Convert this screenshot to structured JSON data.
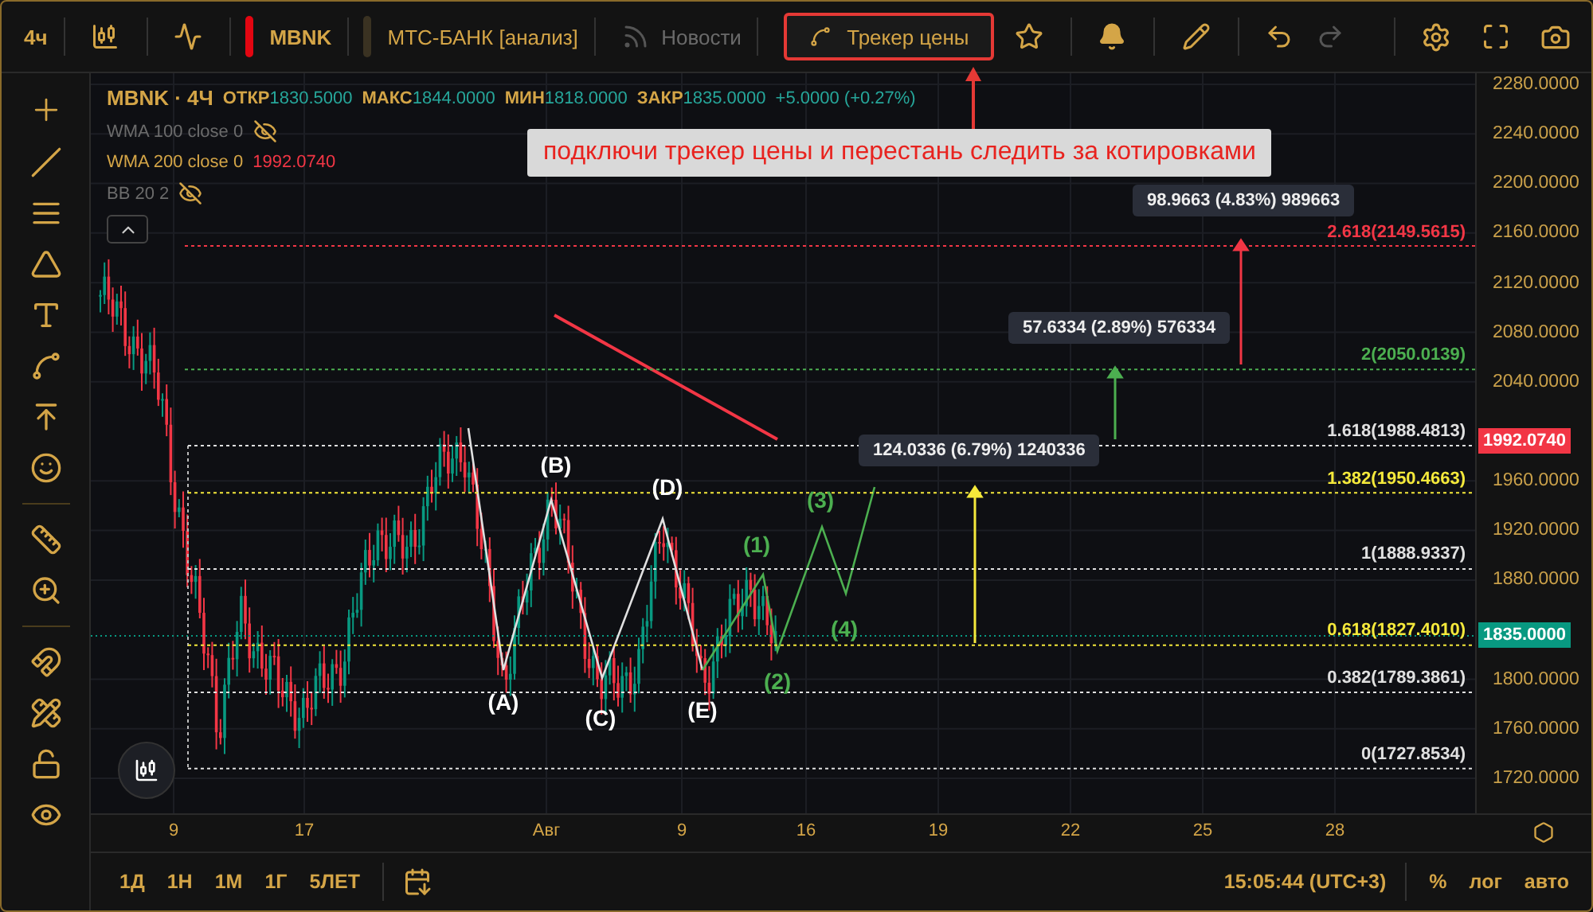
{
  "toolbar": {
    "interval": "4ч",
    "symbol": "MBNK",
    "analysis": "МТС-БАНК [анализ]",
    "news": {
      "label": "Новости",
      "disabled": true
    },
    "tracker": {
      "label": "Трекер цены",
      "highlighted": true
    },
    "redo": {
      "disabled": true
    }
  },
  "callout": {
    "text": "подключи трекер цены и перестань следить за котировками"
  },
  "legend": {
    "title": "MBNK · 4Ч",
    "ohlc": [
      {
        "label": "ОТКР",
        "value": "1830.5000"
      },
      {
        "label": "МАКС",
        "value": "1844.0000"
      },
      {
        "label": "МИН",
        "value": "1818.0000"
      },
      {
        "label": "ЗАКР",
        "value": "1835.0000"
      }
    ],
    "change": "+5.0000 (+0.27%)",
    "indicators": [
      {
        "name": "WMA 100 close 0",
        "visible": false
      },
      {
        "name": "WMA 200 close 0",
        "visible": true,
        "value": "1992.0740"
      },
      {
        "name": "BB 20 2",
        "visible": false
      }
    ]
  },
  "fib_levels": [
    {
      "label": "2.618(2149.5615)",
      "color": "#f23645"
    },
    {
      "label": "2(2050.0139)",
      "color": "#4caf50"
    },
    {
      "label": "1.618(1988.4813)",
      "color": "#e0e0e0"
    },
    {
      "label": "1.382(1950.4663)",
      "color": "#f5e93b"
    },
    {
      "label": "1(1888.9337)",
      "color": "#e0e0e0"
    },
    {
      "label": "0.618(1827.4010)",
      "color": "#f5e93b"
    },
    {
      "label": "0.382(1789.3861)",
      "color": "#e0e0e0"
    },
    {
      "label": "0(1727.8534)",
      "color": "#e0e0e0"
    }
  ],
  "measurements": [
    {
      "text": "98.9663 (4.83%) 989663",
      "color": "#f23645"
    },
    {
      "text": "57.6334 (2.89%) 576334",
      "color": "#4caf50"
    },
    {
      "text": "124.0336 (6.79%) 1240336",
      "color": "#f5e93b"
    }
  ],
  "waves": [
    {
      "label": "(A)",
      "color": "#ffffff"
    },
    {
      "label": "(B)",
      "color": "#ffffff"
    },
    {
      "label": "(C)",
      "color": "#ffffff"
    },
    {
      "label": "(D)",
      "color": "#ffffff"
    },
    {
      "label": "(E)",
      "color": "#ffffff"
    },
    {
      "label": "(1)",
      "color": "#4caf50"
    },
    {
      "label": "(2)",
      "color": "#4caf50"
    },
    {
      "label": "(3)",
      "color": "#4caf50"
    },
    {
      "label": "(4)",
      "color": "#4caf50"
    }
  ],
  "price_axis": {
    "ticks": [
      "2280.0000",
      "2240.0000",
      "2200.0000",
      "2160.0000",
      "2120.0000",
      "2080.0000",
      "2040.0000",
      "1960.0000",
      "1920.0000",
      "1880.0000",
      "1800.0000",
      "1760.0000",
      "1720.0000"
    ],
    "badges": [
      {
        "value": "1992.0740",
        "color": "#f23645"
      },
      {
        "value": "1835.0000",
        "color": "#089981"
      }
    ]
  },
  "time_axis": [
    "9",
    "17",
    "Авг",
    "9",
    "16",
    "19",
    "22",
    "25",
    "28"
  ],
  "bottom_bar": {
    "ranges": [
      "1Д",
      "1Н",
      "1М",
      "1Г",
      "5ЛЕТ"
    ],
    "clock": "15:05:44 (UTC+3)",
    "options": [
      "%",
      "лог",
      "авто"
    ]
  }
}
